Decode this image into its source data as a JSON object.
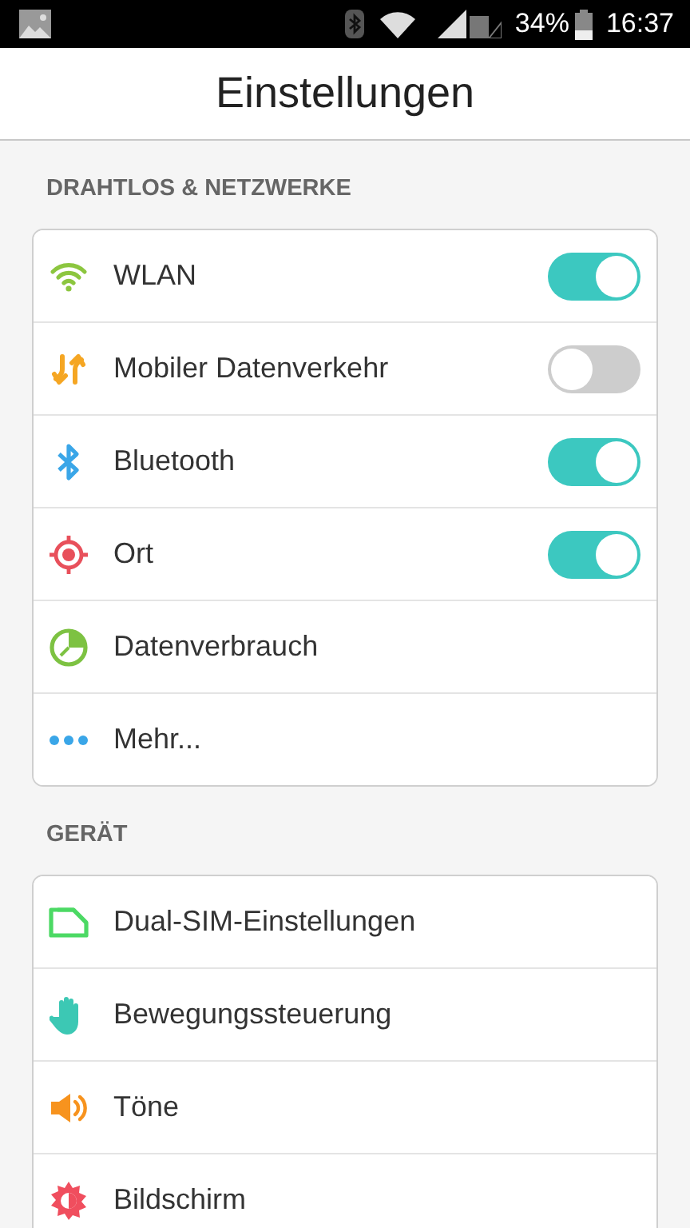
{
  "status_bar": {
    "battery": "34%",
    "time": "16:37"
  },
  "title": "Einstellungen",
  "sections": [
    {
      "header": "DRAHTLOS & NETZWERKE",
      "items": [
        {
          "label": "WLAN",
          "kind": "toggle",
          "on": true
        },
        {
          "label": "Mobiler Datenverkehr",
          "kind": "toggle",
          "on": false
        },
        {
          "label": "Bluetooth",
          "kind": "toggle",
          "on": true
        },
        {
          "label": "Ort",
          "kind": "toggle",
          "on": true
        },
        {
          "label": "Datenverbrauch",
          "kind": "link"
        },
        {
          "label": "Mehr...",
          "kind": "link"
        }
      ]
    },
    {
      "header": "GERÄT",
      "items": [
        {
          "label": "Dual-SIM-Einstellungen",
          "kind": "link"
        },
        {
          "label": "Bewegungssteuerung",
          "kind": "link"
        },
        {
          "label": "Töne",
          "kind": "link"
        },
        {
          "label": "Bildschirm",
          "kind": "link"
        }
      ]
    }
  ]
}
